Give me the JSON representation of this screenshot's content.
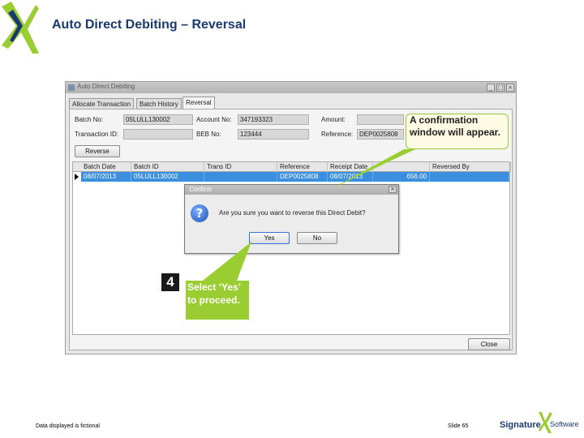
{
  "slide": {
    "title": "Auto Direct Debiting – Reversal",
    "footer_note": "Data displayed is fictional",
    "slide_number": "Slide 65",
    "brand_signature": "Signature",
    "brand_software": "Software"
  },
  "window": {
    "title": "Auto Direct Debiting",
    "tabs": [
      {
        "label": "Allocate Transaction",
        "active": false
      },
      {
        "label": "Batch History",
        "active": false
      },
      {
        "label": "Reversal",
        "active": true
      }
    ],
    "fields": {
      "batch_no_label": "Batch No:",
      "batch_no_value": "05LULL130002",
      "transaction_id_label": "Transaction ID:",
      "transaction_id_value": "",
      "account_no_label": "Account No:",
      "account_no_value": "347193323",
      "beb_no_label": "BEB No:",
      "beb_no_value": "123444",
      "amount_label": "Amount:",
      "amount_value": "",
      "reference_label": "Reference:",
      "reference_value": "DEP0025808"
    },
    "reverse_button": "Reverse",
    "close_button": "Close",
    "grid": {
      "columns": [
        "Batch Date",
        "Batch ID",
        "Trans ID",
        "Reference",
        "Receipt Date",
        "",
        "Reversed By"
      ],
      "rows": [
        [
          "08/07/2013",
          "05LULL130002",
          "",
          "DEP0025808",
          "08/07/2013",
          "656.00",
          ""
        ]
      ]
    }
  },
  "dialog": {
    "title": "Confirm",
    "message": "Are you sure you want to reverse this Direct Debit?",
    "yes_button": "Yes",
    "no_button": "No"
  },
  "callouts": {
    "confirmation": "A confirmation window will appear.",
    "step_number": "4",
    "select": "Select ‘Yes’ to proceed."
  },
  "colors": {
    "title": "#1a3a6e",
    "callout_green": "#9acd32",
    "row_highlight": "#3a8fde"
  }
}
